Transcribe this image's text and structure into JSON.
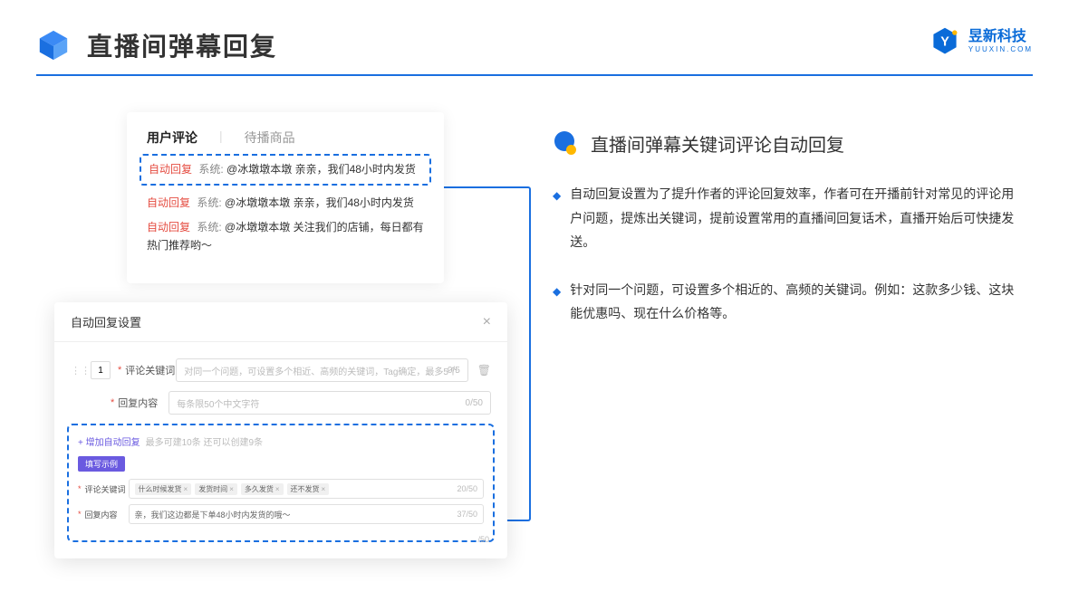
{
  "header": {
    "title": "直播间弹幕回复"
  },
  "brand": {
    "cn": "昱新科技",
    "en": "YUUXIN.COM"
  },
  "comments": {
    "tabs": {
      "active": "用户评论",
      "inactive": "待播商品"
    },
    "rows": [
      {
        "tag": "自动回复",
        "sys": "系统:",
        "msg": "@冰墩墩本墩 亲亲，我们48小时内发货"
      },
      {
        "tag": "自动回复",
        "sys": "系统:",
        "msg": "@冰墩墩本墩 亲亲，我们48小时内发货"
      },
      {
        "tag": "自动回复",
        "sys": "系统:",
        "msg": "@冰墩墩本墩 关注我们的店铺，每日都有热门推荐哟～"
      }
    ]
  },
  "modal": {
    "title": "自动回复设置",
    "num": "1",
    "fields": {
      "kw_label": "评论关键词",
      "kw_placeholder": "对同一个问题，可设置多个相近、高频的关键词，Tag确定，最多5个",
      "kw_cnt": "0/5",
      "rc_label": "回复内容",
      "rc_placeholder": "每条限50个中文字符",
      "rc_cnt": "0/50"
    },
    "add": {
      "link": "+ 增加自动回复",
      "hint": "最多可建10条 还可以创建9条"
    },
    "example": {
      "badge": "填写示例",
      "kw_label": "评论关键词",
      "chips": [
        "什么时候发货",
        "发货时间",
        "多久发货",
        "还不发货"
      ],
      "kw_cnt": "20/50",
      "rc_label": "回复内容",
      "rc_text": "亲，我们这边都是下单48小时内发货的哦～",
      "rc_cnt": "37/50"
    },
    "outer_cnt": "/50"
  },
  "right": {
    "title": "直播间弹幕关键词评论自动回复",
    "bullets": [
      "自动回复设置为了提升作者的评论回复效率，作者可在开播前针对常见的评论用户问题，提炼出关键词，提前设置常用的直播间回复话术，直播开始后可快捷发送。",
      "针对同一个问题，可设置多个相近的、高频的关键词。例如：这款多少钱、这块能优惠吗、现在什么价格等。"
    ]
  }
}
